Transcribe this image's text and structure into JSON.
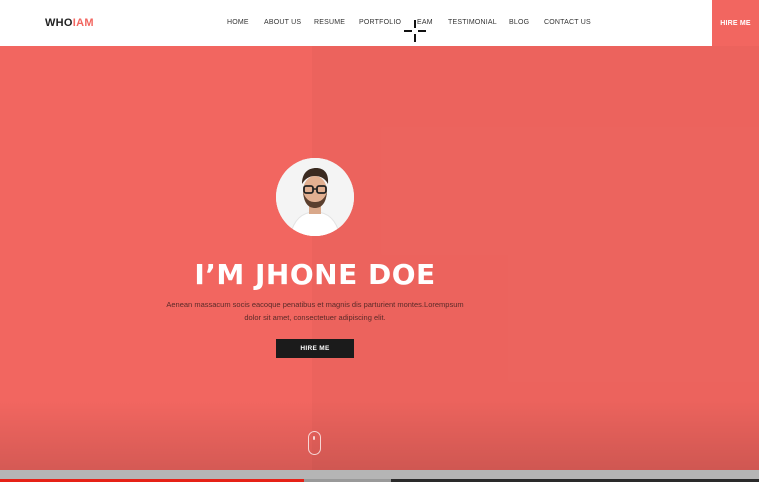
{
  "brand": {
    "logo_prefix": "WHO",
    "logo_accent": "IAM"
  },
  "nav": {
    "items": [
      {
        "id": "home",
        "label": "HOME"
      },
      {
        "id": "about",
        "label": "ABOUT US"
      },
      {
        "id": "resume",
        "label": "RESUME"
      },
      {
        "id": "portfolio",
        "label": "PORTFOLIO"
      },
      {
        "id": "team",
        "label": "EAM"
      },
      {
        "id": "testimonial",
        "label": "TESTIMONIAL"
      },
      {
        "id": "blog",
        "label": "BLOG"
      },
      {
        "id": "contact",
        "label": "CONTACT US"
      }
    ],
    "hire_label": "HIRE ME"
  },
  "hero": {
    "title": "I’M JHONE DOE",
    "description_line1": "Aenean massacum socis eacoque penatibus et magnis dis parturient montes.Lorempsum",
    "description_line2": "dolor sit amet, consectetuer adipiscing elit.",
    "button_label": "HIRE ME"
  },
  "video": {
    "played_fraction": 0.4,
    "buffered_fraction": 0.515
  },
  "colors": {
    "accent": "#f26660",
    "dark": "#1b1b1b",
    "header_bg": "#ffffff",
    "progress_red": "#e62117"
  },
  "icons": {
    "scroll": "mouse-scroll-icon",
    "cursor": "crosshair-cursor-icon",
    "avatar": "profile-photo"
  }
}
